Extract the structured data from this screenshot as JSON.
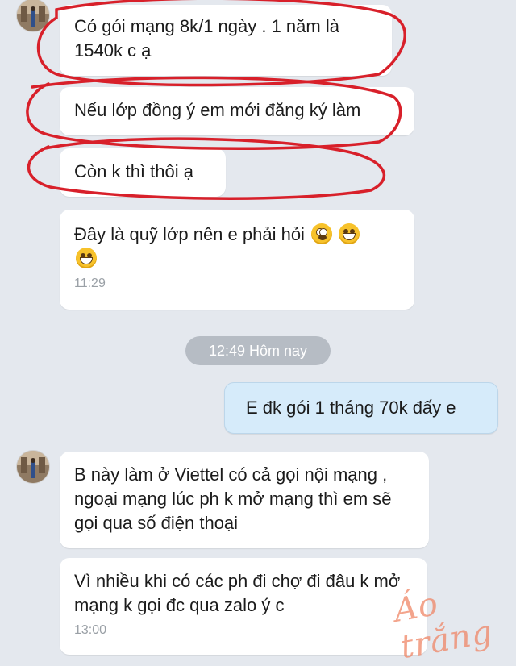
{
  "messages": [
    {
      "text": "Có gói mạng 8k/1 ngày . 1 năm là 1540k c ạ"
    },
    {
      "text": "Nếu lớp đồng ý em mới đăng ký làm"
    },
    {
      "text": "Còn k thì thôi ạ"
    },
    {
      "text": "Đây là quỹ lớp nên e phải hỏi",
      "emojis": [
        "dizzy-face-emoji",
        "grinning-face-emoji",
        "grinning-face-emoji"
      ],
      "time": "11:29"
    },
    {
      "text": "E đk gói 1 tháng 70k đấy e"
    },
    {
      "text": "B này làm ở Viettel có cả gọi nội mạng , ngoại mạng lúc ph k mở mạng thì em sẽ gọi qua số điện thoại"
    },
    {
      "text": "Vì nhiều khi có các ph đi chợ đi đâu k mở mạng k gọi đc qua zalo ý c",
      "time": "13:00"
    }
  ],
  "separator": {
    "time": "12:49",
    "label": "Hôm nay"
  },
  "watermark": "Áo trắng",
  "colors": {
    "background": "#e4e8ee",
    "incoming_bubble": "#ffffff",
    "outgoing_bubble": "#d6ebfa",
    "separator": "#b6bcc4",
    "annotation_red": "#d8202a",
    "watermark": "#ef8666"
  }
}
